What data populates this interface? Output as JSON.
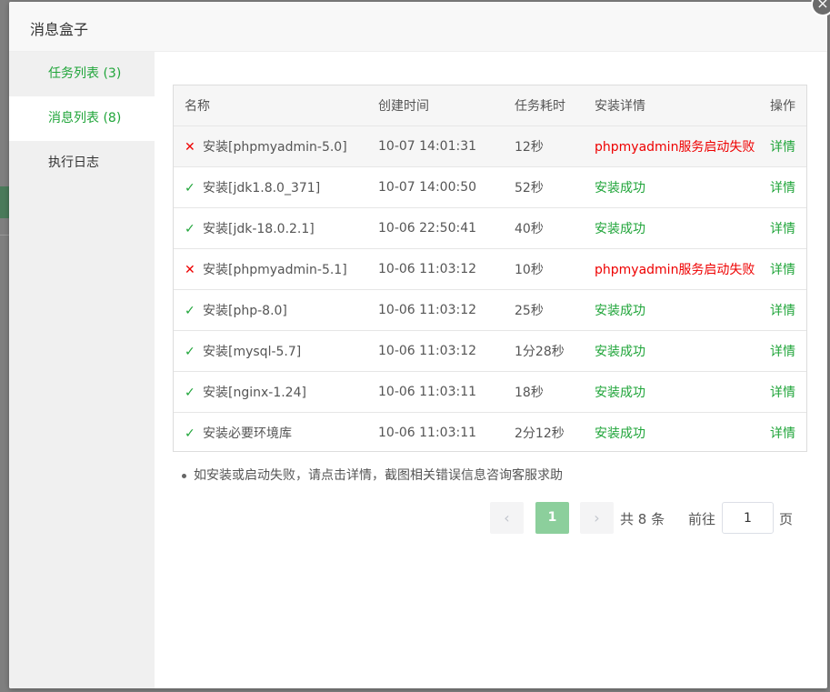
{
  "dialog": {
    "title": "消息盒子",
    "close_icon": "×"
  },
  "sidebar": {
    "items": [
      {
        "label": "任务列表 (3)"
      },
      {
        "label": "消息列表 (8)"
      },
      {
        "label": "执行日志"
      }
    ]
  },
  "table": {
    "headers": [
      "名称",
      "创建时间",
      "任务耗时",
      "安装详情",
      "操作"
    ],
    "rows": [
      {
        "status": "fail",
        "name": "安装[phpmyadmin-5.0]",
        "time": "10-07 14:01:31",
        "duration": "12秒",
        "detail": "phpmyadmin服务启动失败",
        "action": "详情"
      },
      {
        "status": "ok",
        "name": "安装[jdk1.8.0_371]",
        "time": "10-07 14:00:50",
        "duration": "52秒",
        "detail": "安装成功",
        "action": "详情"
      },
      {
        "status": "ok",
        "name": "安装[jdk-18.0.2.1]",
        "time": "10-06 22:50:41",
        "duration": "40秒",
        "detail": "安装成功",
        "action": "详情"
      },
      {
        "status": "fail",
        "name": "安装[phpmyadmin-5.1]",
        "time": "10-06 11:03:12",
        "duration": "10秒",
        "detail": "phpmyadmin服务启动失败",
        "action": "详情"
      },
      {
        "status": "ok",
        "name": "安装[php-8.0]",
        "time": "10-06 11:03:12",
        "duration": "25秒",
        "detail": "安装成功",
        "action": "详情"
      },
      {
        "status": "ok",
        "name": "安装[mysql-5.7]",
        "time": "10-06 11:03:12",
        "duration": "1分28秒",
        "detail": "安装成功",
        "action": "详情"
      },
      {
        "status": "ok",
        "name": "安装[nginx-1.24]",
        "time": "10-06 11:03:11",
        "duration": "18秒",
        "detail": "安装成功",
        "action": "详情"
      },
      {
        "status": "ok",
        "name": "安装必要环境库",
        "time": "10-06 11:03:11",
        "duration": "2分12秒",
        "detail": "安装成功",
        "action": "详情"
      }
    ]
  },
  "note": "如安装或启动失败，请点击详情，截图相关错误信息咨询客服求助",
  "pagination": {
    "prev_icon": "‹",
    "next_icon": "›",
    "current_page": "1",
    "total_text": "共 8 条",
    "goto_label": "前往",
    "goto_value": "1",
    "page_unit": "页"
  },
  "icons": {
    "ok": "✓",
    "fail": "✕"
  },
  "colors": {
    "accent": "#20a53a",
    "error": "#ee0000",
    "active_page": "#8ccf9c"
  }
}
